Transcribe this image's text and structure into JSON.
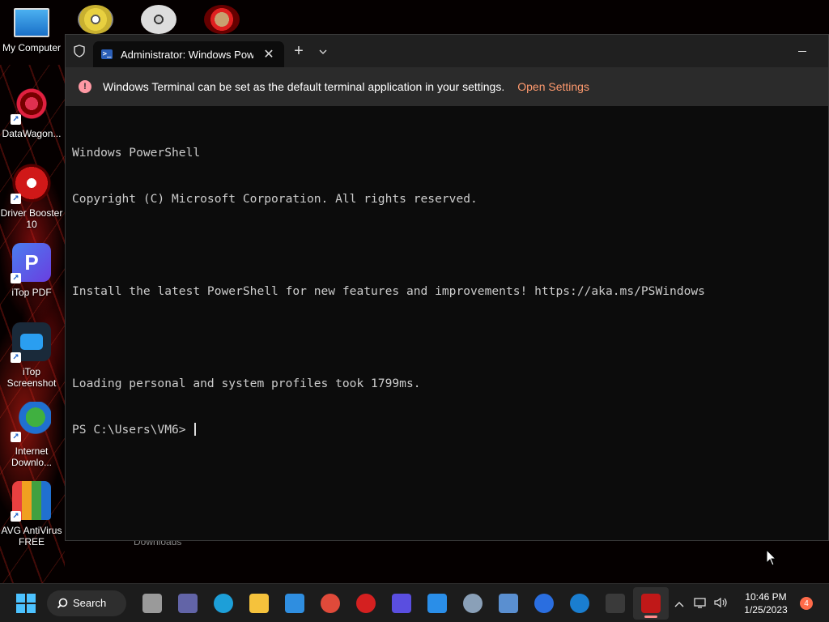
{
  "desktop": {
    "icons": [
      {
        "label": "My Computer"
      },
      {
        "label": "DataWagon..."
      },
      {
        "label": "Driver Booster 10"
      },
      {
        "label": "iTop PDF"
      },
      {
        "label": "iTop Screenshot"
      },
      {
        "label": "Internet Downlo..."
      },
      {
        "label": "AVG AntiVirus FREE"
      }
    ],
    "downloads_label": "Downloads"
  },
  "terminal": {
    "tab_title": "Administrator: Windows PowerShell",
    "new_tab_glyph": "+",
    "close_glyph": "✕",
    "dropdown_glyph": "⌄",
    "infobar": {
      "message": "Windows Terminal can be set as the default terminal application in your settings.",
      "action": "Open Settings"
    },
    "console_lines": [
      "Windows PowerShell",
      "Copyright (C) Microsoft Corporation. All rights reserved.",
      "",
      "Install the latest PowerShell for new features and improvements! https://aka.ms/PSWindows",
      "",
      "Loading personal and system profiles took 1799ms.",
      "PS C:\\Users\\VM6> "
    ]
  },
  "taskbar": {
    "search_label": "Search",
    "apps": [
      {
        "name": "task-view",
        "color": "#9a9a9a"
      },
      {
        "name": "teams-chat",
        "color": "#6264a7"
      },
      {
        "name": "edge",
        "color": "#1d9fd8"
      },
      {
        "name": "file-explorer",
        "color": "#f5c23c"
      },
      {
        "name": "microsoft-store",
        "color": "#2f8ee0"
      },
      {
        "name": "chrome",
        "color": "#e04a3a"
      },
      {
        "name": "driver-booster",
        "color": "#d42020"
      },
      {
        "name": "itop-pdf",
        "color": "#5a4ee0"
      },
      {
        "name": "itop-screenshot",
        "color": "#2a8ee8"
      },
      {
        "name": "settings",
        "color": "#8aa0b8"
      },
      {
        "name": "photo-viewer",
        "color": "#5a8fd0"
      },
      {
        "name": "vpn-shield",
        "color": "#2a6ee0"
      },
      {
        "name": "ccleaner",
        "color": "#1a7ed0"
      },
      {
        "name": "terminal",
        "color": "#3a3a3a"
      },
      {
        "name": "mcafee",
        "color": "#c01818"
      }
    ],
    "time": "10:46 PM",
    "date": "1/25/2023",
    "notification_count": "4"
  }
}
